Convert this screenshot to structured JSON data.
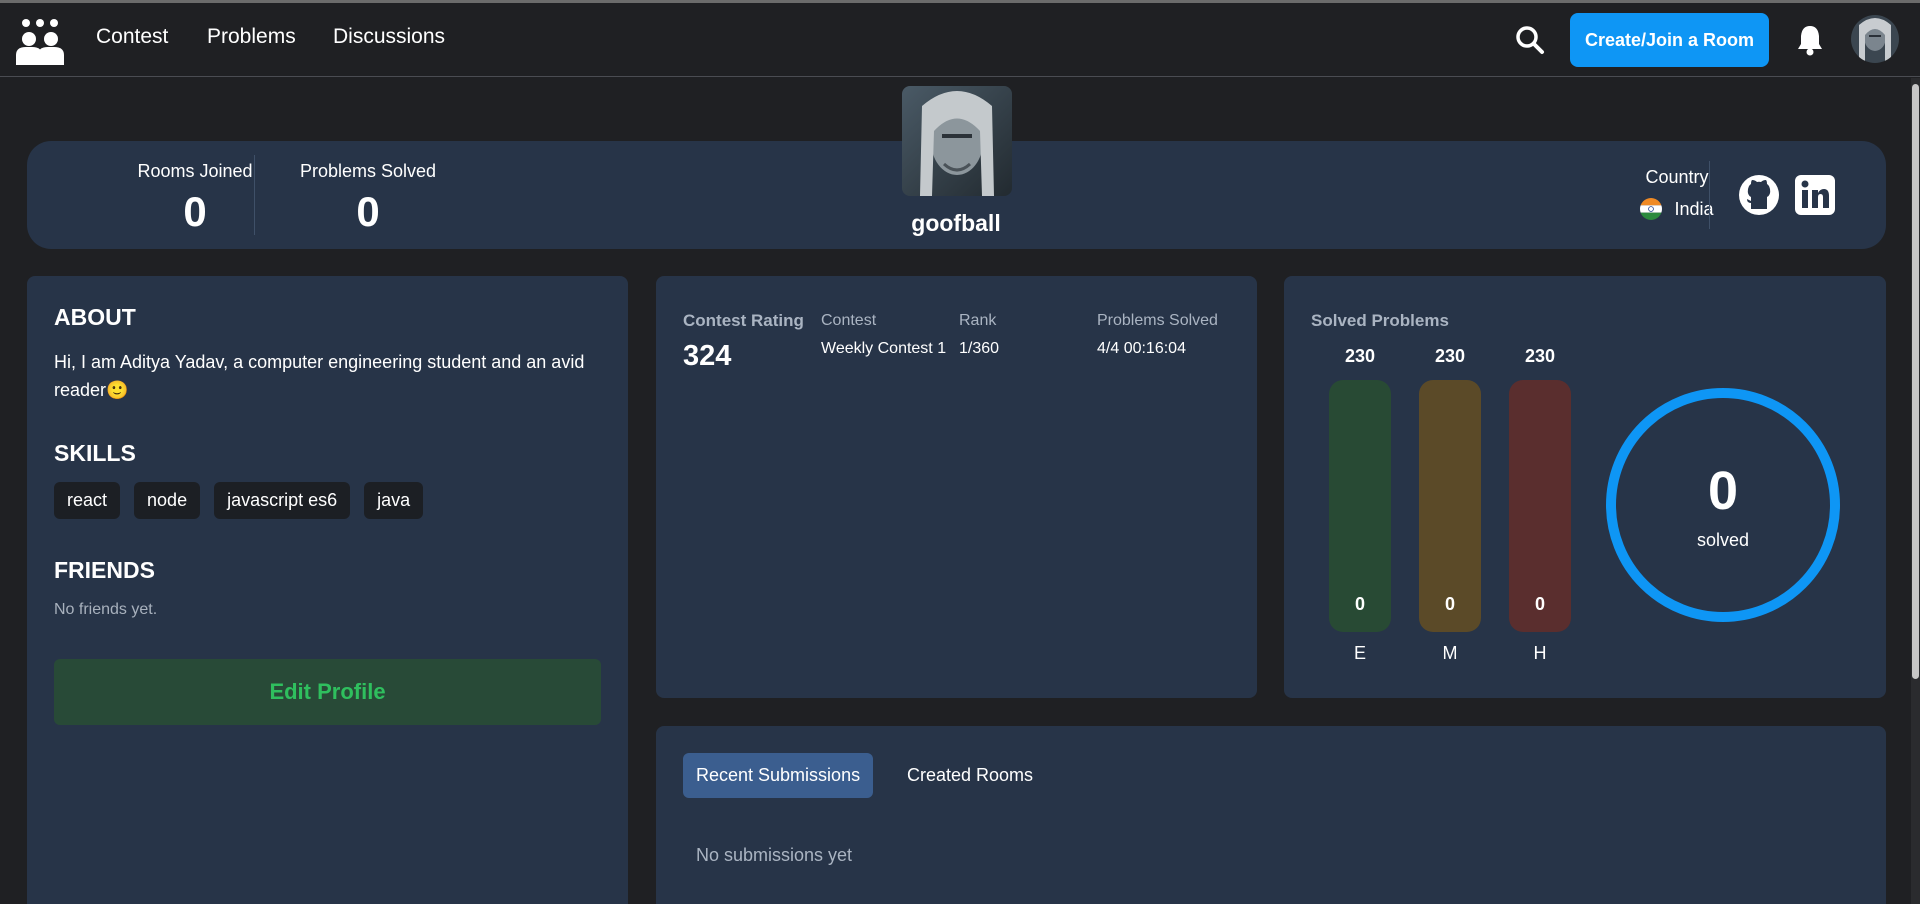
{
  "nav": {
    "links": [
      "Contest",
      "Problems",
      "Discussions"
    ],
    "create_button": "Create/Join a Room"
  },
  "stats": {
    "rooms_joined_label": "Rooms Joined",
    "rooms_joined_value": "0",
    "problems_solved_label": "Problems Solved",
    "problems_solved_value": "0",
    "username": "goofball",
    "country_label": "Country",
    "country_value": "India"
  },
  "about": {
    "title": "ABOUT",
    "text": "Hi, I am Aditya Yadav, a computer engineering student and an avid reader🙂",
    "skills_title": "SKILLS",
    "skills": [
      "react",
      "node",
      "javascript es6",
      "java"
    ],
    "friends_title": "FRIENDS",
    "friends_empty": "No friends yet.",
    "edit_button": "Edit Profile"
  },
  "contest": {
    "rating_label": "Contest Rating",
    "rating_value": "324",
    "headers": [
      "Contest",
      "Rank",
      "Problems Solved"
    ],
    "rows": [
      [
        "Weekly Contest 1",
        "1/360",
        "4/4 00:16:04"
      ]
    ]
  },
  "solved": {
    "title": "Solved Problems",
    "bars": [
      {
        "total": "230",
        "count": "0",
        "letter": "E",
        "color": "#284a34"
      },
      {
        "total": "230",
        "count": "0",
        "letter": "M",
        "color": "#5b4a28"
      },
      {
        "total": "230",
        "count": "0",
        "letter": "H",
        "color": "#5a2e2e"
      }
    ],
    "ring_value": "0",
    "ring_label": "solved",
    "ring_color": "#0e96f5"
  },
  "submissions": {
    "tabs": [
      "Recent Submissions",
      "Created Rooms"
    ],
    "active_tab": "Recent Submissions",
    "empty": "No submissions yet"
  }
}
